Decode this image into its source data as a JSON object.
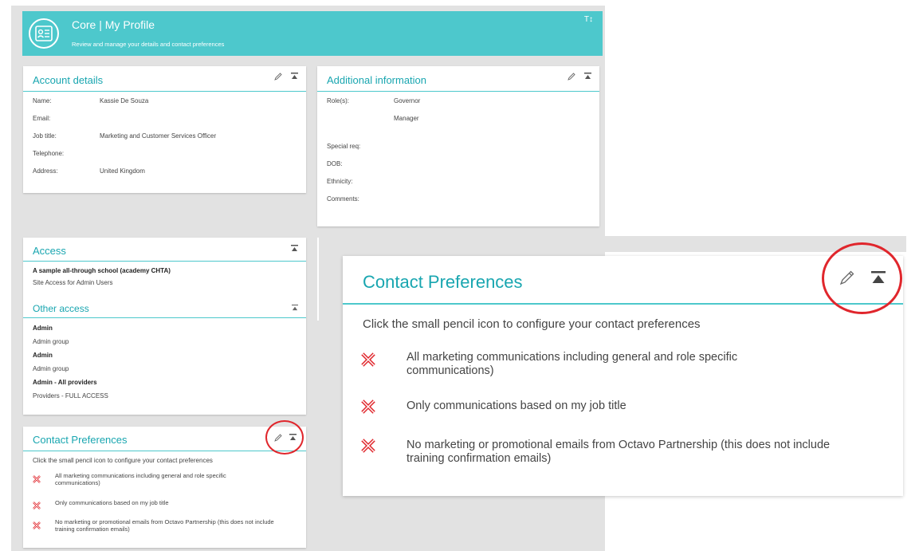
{
  "header": {
    "title": "Core | My Profile",
    "subtitle": "Review and manage your details and contact preferences",
    "text_size_label": "T↕"
  },
  "account_details": {
    "title": "Account details",
    "fields": [
      {
        "label": "Name:",
        "value": "Kassie De Souza"
      },
      {
        "label": "Email:",
        "value": ""
      },
      {
        "label": "Job title:",
        "value": "Marketing and Customer Services Officer"
      },
      {
        "label": "Telephone:",
        "value": ""
      },
      {
        "label": "Address:",
        "value": "United Kingdom"
      }
    ]
  },
  "additional_information": {
    "title": "Additional information",
    "roles_label": "Role(s):",
    "roles": [
      "Governor",
      "Manager"
    ],
    "fields": [
      {
        "label": "Special req:"
      },
      {
        "label": "DOB:"
      },
      {
        "label": "Ethnicity:"
      },
      {
        "label": "Comments:"
      }
    ]
  },
  "access": {
    "title": "Access",
    "school": "A sample all-through school (academy CHTA)",
    "site_access": "Site Access for Admin Users",
    "other_access_title": "Other access",
    "entries": [
      {
        "name": "Admin",
        "detail": "Admin group"
      },
      {
        "name": "Admin",
        "detail": "Admin group"
      },
      {
        "name": "Admin - All providers",
        "detail": "Providers - FULL ACCESS"
      }
    ]
  },
  "contact_preferences": {
    "title": "Contact Preferences",
    "intro": "Click the small pencil icon to configure your contact preferences",
    "items": [
      "All marketing communications including general and role specific communications)",
      "Only communications based on my job title",
      "No marketing or promotional emails from Octavo Partnership (this does not include training confirmation emails)"
    ]
  },
  "colors": {
    "accent": "#4dc8cc",
    "title_teal": "#19a6b0",
    "cross_red": "#e0262c",
    "highlight_circle": "#e0262c"
  },
  "icons": [
    "profile-card-icon",
    "text-size-icon",
    "pencil-icon",
    "collapse-icon",
    "cross-icon"
  ]
}
